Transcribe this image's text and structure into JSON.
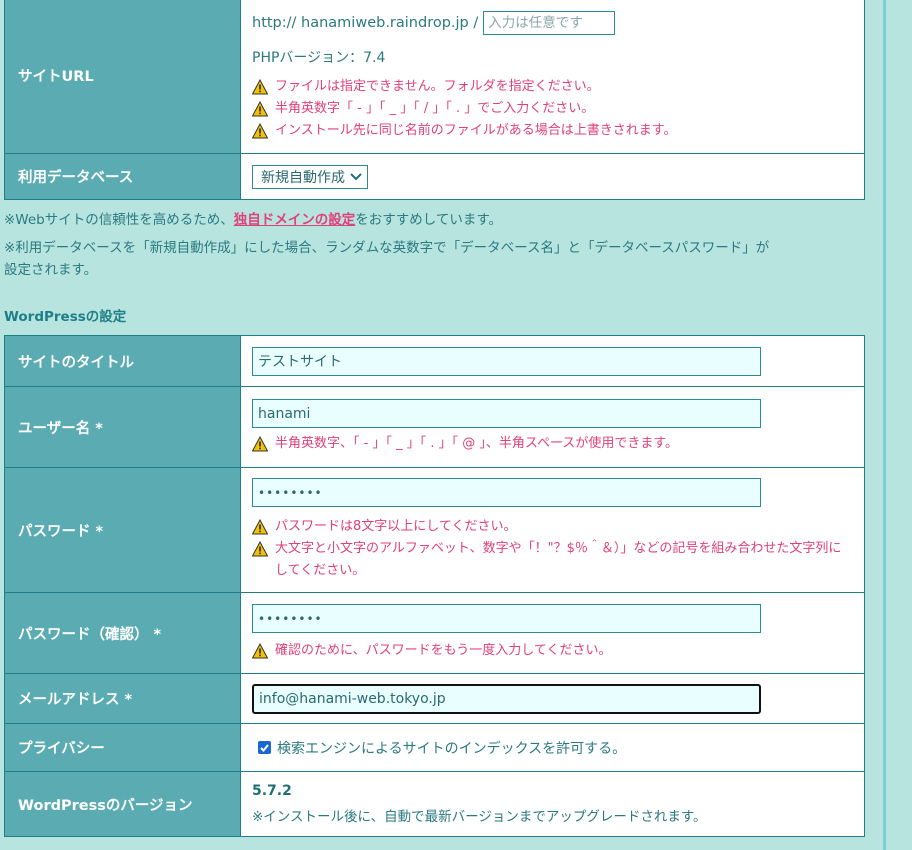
{
  "site_url": {
    "label": "サイトURL",
    "prefix": "http:// hanamiweb.raindrop.jp /",
    "input_placeholder": "入力は任意です",
    "php_version": "PHPバージョン：7.4",
    "warnings": [
      "ファイルは指定できません。フォルダを指定ください。",
      "半角英数字「 - 」「 _ 」「 / 」「 . 」でご入力ください。",
      "インストール先に同じ名前のファイルがある場合は上書きされます。"
    ]
  },
  "database": {
    "label": "利用データベース",
    "selected": "新規自動作成"
  },
  "notes": {
    "line1_before": "※Webサイトの信頼性を高めるため、",
    "line1_link": "独自ドメインの設定",
    "line1_after": "をおすすめしています。",
    "line2": "※利用データベースを「新規自動作成」にした場合、ランダムな英数字で「データベース名」と「データベースパスワード」が",
    "line3": "設定されます。"
  },
  "wordpress_section_title": "WordPressの設定",
  "site_title": {
    "label": "サイトのタイトル",
    "value": "テストサイト"
  },
  "username": {
    "label": "ユーザー名 *",
    "value": "hanami",
    "warning": "半角英数字、「 - 」「 _ 」「 . 」「 @ 」、半角スペースが使用できます。"
  },
  "password": {
    "label": "パスワード *",
    "value": "••••••••",
    "warnings": [
      "パスワードは8文字以上にしてください。",
      "大文字と小文字のアルファベット、数字や「！\"？$％＾＆）」などの記号を組み合わせた文字列にしてください。"
    ]
  },
  "password_confirm": {
    "label": "パスワード（確認） *",
    "value": "••••••••",
    "warning": "確認のために、パスワードをもう一度入力してください。"
  },
  "email": {
    "label": "メールアドレス *",
    "value": "info@hanami-web.tokyo.jp"
  },
  "privacy": {
    "label": "プライバシー",
    "checkbox_label": "検索エンジンによるサイトのインデックスを許可する。",
    "checked": true
  },
  "wp_version": {
    "label": "WordPressのバージョン",
    "value": "5.7.2",
    "note": "※インストール後に、自動で最新バージョンまでアップグレードされます。"
  },
  "icons": {
    "warning": "warning-triangle-icon",
    "chevron": "chevron-down-icon"
  },
  "colors": {
    "label_bg": "#5aacb2",
    "page_bg": "#b8e4e0",
    "warning": "#e0407a",
    "border": "#1f7f86"
  }
}
